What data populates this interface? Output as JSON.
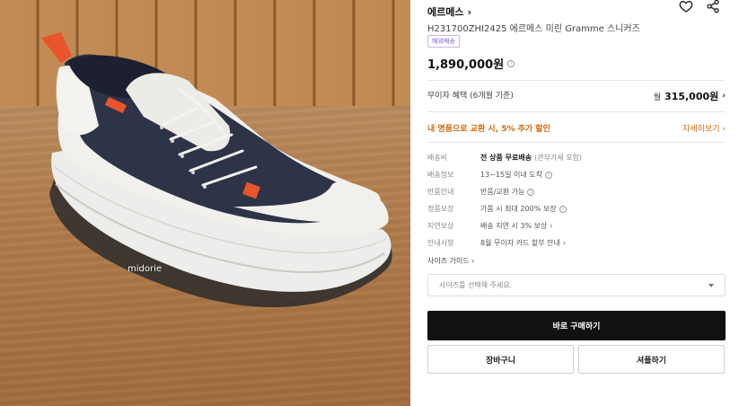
{
  "photo": {
    "watermark": "midorie"
  },
  "product": {
    "brand": "에르메스",
    "title": "H231700ZHI2425 에르메스 미린 Gramme 스니커즈",
    "tag": "해외배송",
    "price": "1,890,000원",
    "icons": [
      "heart-icon",
      "share-icon"
    ]
  },
  "interest": {
    "label": "무이자 혜택 (6개월 기준)",
    "currency": "월",
    "value": "315,000원"
  },
  "exchange": {
    "label": "내 명품으로 교환 시, 5% 추가 할인",
    "link": "자세히보기"
  },
  "specs": [
    {
      "key": "배송비",
      "value": "전 상품 무료배송",
      "sub": "(관부가세 포함)"
    },
    {
      "key": "배송정보",
      "value": "13~15일 이내 도착",
      "sub": ""
    },
    {
      "key": "반품안내",
      "value": "반품/교환 가능",
      "sub": ""
    },
    {
      "key": "정품보장",
      "value": "가품 시 최대 200% 보장",
      "sub": ""
    },
    {
      "key": "지연보상",
      "value": "배송 지연 시 3% 보상",
      "sub": ""
    },
    {
      "key": "안내사항",
      "value": "8월 무이자 카드 할부 안내",
      "sub": ""
    }
  ],
  "size_guide": "사이즈 가이드",
  "size_select": {
    "placeholder": "사이즈를 선택해 주세요."
  },
  "buttons": {
    "buy": "바로 구매하기",
    "cart": "장바구니",
    "showroom": "셔플하기"
  },
  "colors": {
    "accent": "#d4690f",
    "buy_button": "#111111",
    "tag": "#7d5bc7"
  }
}
